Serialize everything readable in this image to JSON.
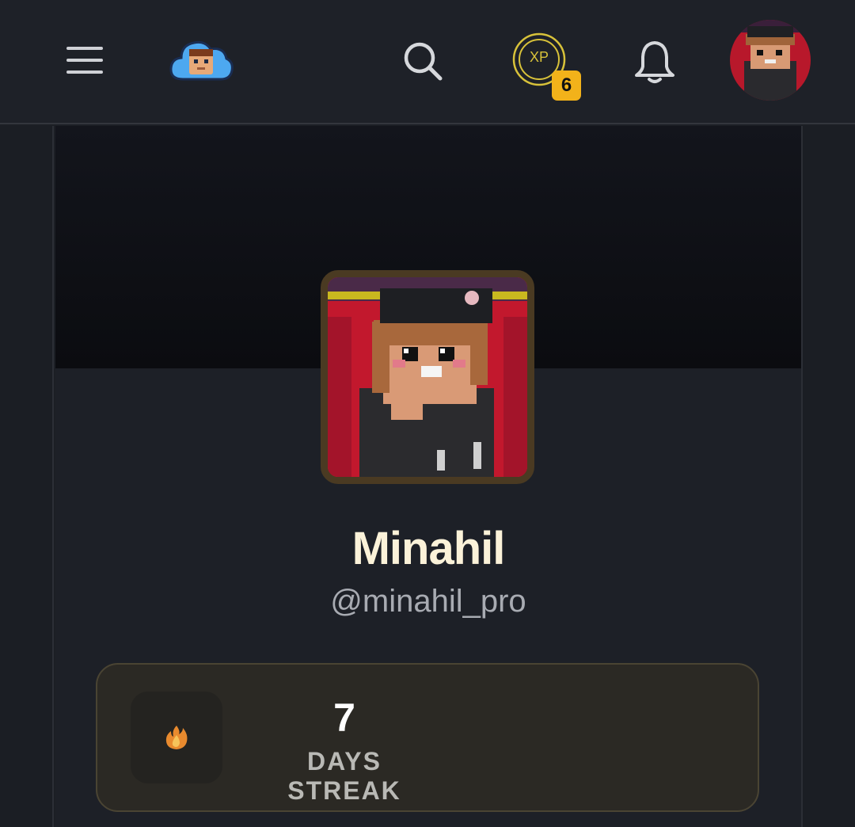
{
  "header": {
    "icons": {
      "menu": "hamburger-menu-icon",
      "logo": "cloud-avatar-logo",
      "search": "search-icon",
      "xp": "xp-coin-icon",
      "notifications": "bell-icon"
    },
    "xp_label": "XP",
    "xp_badge_count": "6"
  },
  "profile": {
    "display_name": "Minahil",
    "handle": "@minahil_pro"
  },
  "streak": {
    "count": "7",
    "label": "DAYS STREAK",
    "icon": "fire-icon"
  },
  "colors": {
    "background": "#1c1f25",
    "accent_gold": "#f2b21a",
    "name_color": "#fbf2d9",
    "streak_card": "#2b2924"
  }
}
